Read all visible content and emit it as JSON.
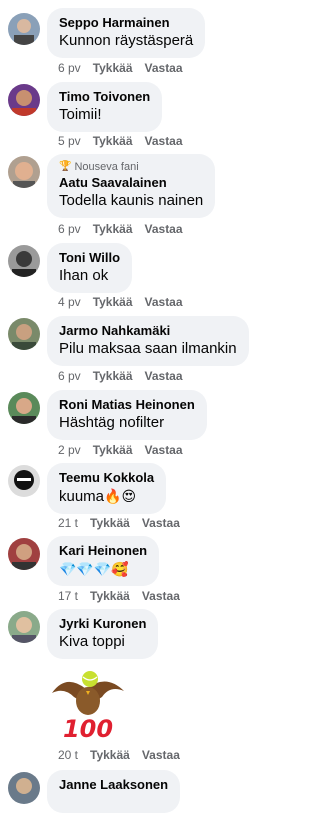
{
  "comments": [
    {
      "name": "Seppo Harmainen",
      "text": "Kunnon räystäsperä",
      "time": "6 pv",
      "like": "Tykkää",
      "reply": "Vastaa"
    },
    {
      "name": "Timo Toivonen",
      "text": "Toimii!",
      "time": "5 pv",
      "like": "Tykkää",
      "reply": "Vastaa"
    },
    {
      "name": "Aatu Saavalainen",
      "badge": "Nouseva fani",
      "text": "Todella kaunis nainen",
      "time": "6 pv",
      "like": "Tykkää",
      "reply": "Vastaa"
    },
    {
      "name": "Toni Willo",
      "text": "Ihan ok",
      "time": "4 pv",
      "like": "Tykkää",
      "reply": "Vastaa"
    },
    {
      "name": "Jarmo Nahkamäki",
      "text": "Pilu maksaa saan ilmankin",
      "time": "6 pv",
      "like": "Tykkää",
      "reply": "Vastaa"
    },
    {
      "name": "Roni Matias Heinonen",
      "text": "Häshtäg nofilter",
      "time": "2 pv",
      "like": "Tykkää",
      "reply": "Vastaa"
    },
    {
      "name": "Teemu Kokkola",
      "text": "kuuma",
      "emoji": "🔥😍",
      "time": "21 t",
      "like": "Tykkää",
      "reply": "Vastaa"
    },
    {
      "name": "Kari Heinonen",
      "emoji": "💎💎💎🥰",
      "time": "17 t",
      "like": "Tykkää",
      "reply": "Vastaa"
    },
    {
      "name": "Jyrki Kuronen",
      "text": "Kiva toppi",
      "time": "20 t",
      "like": "Tykkää",
      "reply": "Vastaa",
      "sticker": "100"
    },
    {
      "name": "Janne Laaksonen"
    }
  ],
  "colors": {
    "bubble": "#f0f2f5",
    "meta": "#65676b",
    "text": "#050505"
  },
  "icons": {
    "badge": "trophy-icon"
  }
}
